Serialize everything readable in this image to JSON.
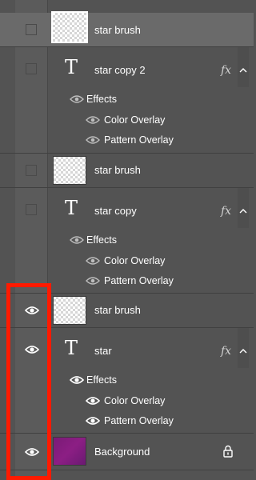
{
  "layers_panel": {
    "layers": [
      {
        "name": "star brush",
        "type": "smart-object",
        "visible": false,
        "selected": true
      },
      {
        "name": "star copy 2",
        "type": "text",
        "visible": false,
        "fx": "fx",
        "effects": {
          "label": "Effects",
          "items": [
            "Color Overlay",
            "Pattern Overlay"
          ]
        }
      },
      {
        "name": "star brush",
        "type": "smart-object",
        "visible": false
      },
      {
        "name": "star copy",
        "type": "text",
        "visible": false,
        "fx": "fx",
        "effects": {
          "label": "Effects",
          "items": [
            "Color Overlay",
            "Pattern Overlay"
          ]
        }
      },
      {
        "name": "star brush",
        "type": "smart-object",
        "visible": true
      },
      {
        "name": "star",
        "type": "text",
        "visible": true,
        "fx": "fx",
        "effects": {
          "label": "Effects",
          "items": [
            "Color Overlay",
            "Pattern Overlay"
          ]
        }
      },
      {
        "name": "Background",
        "type": "background",
        "visible": true,
        "locked": true
      }
    ]
  },
  "colors": {
    "panel_bg": "#535353",
    "selected_row_bg": "#6a6a6a",
    "highlight_border": "#ff1a00",
    "background_thumb": "#7a1b76"
  },
  "icons": {
    "visibility": "eye-icon",
    "text_layer": "T",
    "effects_toggle": "chevron-up-icon",
    "lock": "lock-icon"
  }
}
